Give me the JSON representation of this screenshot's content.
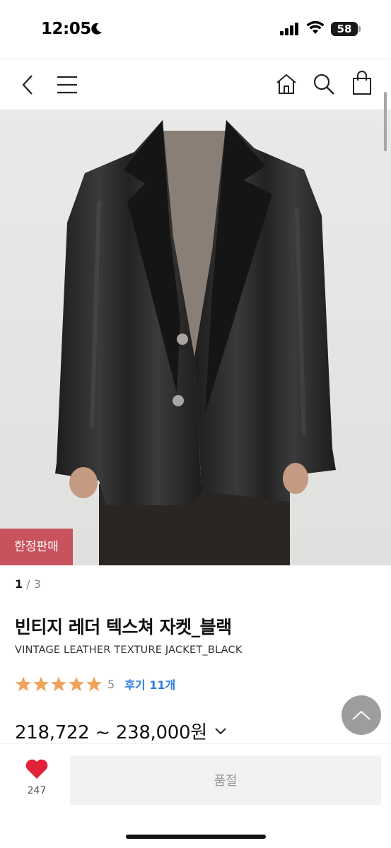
{
  "status_bar": {
    "time": "12:05",
    "battery": "58"
  },
  "product": {
    "badge": "한정판매",
    "pager": {
      "current": "1",
      "separator": " / ",
      "total": "3"
    },
    "title_ko": "빈티지 레더 텍스쳐 자켓_블랙",
    "title_en": "VINTAGE LEATHER TEXTURE JACKET_BLACK",
    "rating": {
      "stars": 5,
      "score": "5",
      "review_link": "후기 11개"
    },
    "price_range": "218,722 ~ 238,000원"
  },
  "bottom_bar": {
    "like_count": "247",
    "buy_button_label": "품절"
  },
  "colors": {
    "badge": "#c8535e",
    "star": "#f0a35b",
    "review_link": "#2f7de1",
    "heart": "#e3223a"
  }
}
